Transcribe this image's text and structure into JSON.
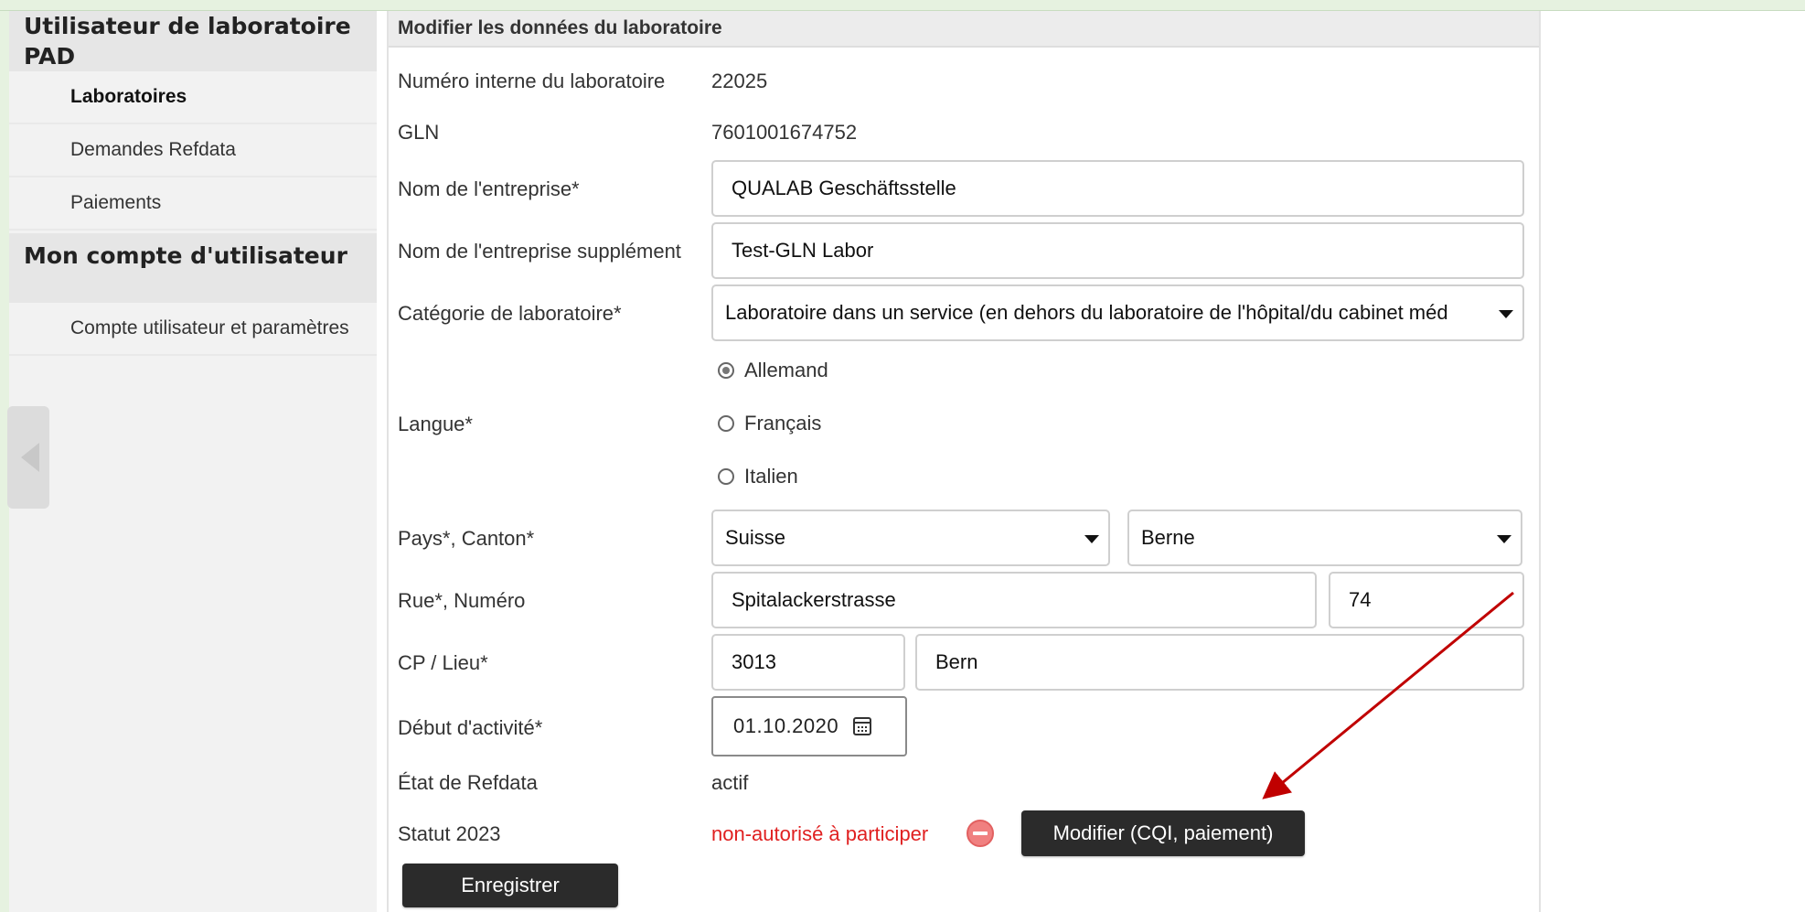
{
  "sidebar": {
    "section1": "Utilisateur de laboratoire PAD",
    "items1": [
      {
        "label": "Laboratoires"
      },
      {
        "label": "Demandes Refdata"
      },
      {
        "label": "Paiements"
      }
    ],
    "section2": "Mon compte d'utilisateur",
    "items2": [
      {
        "label": "Compte utilisateur et paramètres"
      }
    ]
  },
  "panel": {
    "title": "Modifier les données du laboratoire"
  },
  "form": {
    "internal_no_label": "Numéro interne du laboratoire",
    "internal_no": "22025",
    "gln_label": "GLN",
    "gln": "7601001674752",
    "company_label": "Nom de l'entreprise*",
    "company": "QUALAB Geschäftsstelle",
    "company_extra_label": "Nom de l'entreprise supplément",
    "company_extra": "Test-GLN Labor",
    "category_label": "Catégorie de laboratoire*",
    "category": "Laboratoire dans un service (en dehors du laboratoire de l'hôpital/du cabinet méd",
    "language_label": "Langue*",
    "languages": [
      {
        "label": "Allemand",
        "selected": true
      },
      {
        "label": "Français",
        "selected": false
      },
      {
        "label": "Italien",
        "selected": false
      }
    ],
    "country_canton_label": "Pays*, Canton*",
    "country": "Suisse",
    "canton": "Berne",
    "street_label": "Rue*, Numéro",
    "street": "Spitalackerstrasse",
    "number": "74",
    "zip_city_label": "CP / Lieu*",
    "zip": "3013",
    "city": "Bern",
    "start_label": "Début d'activité*",
    "start_date": "01.10.2020",
    "refdata_label": "État de Refdata",
    "refdata_state": "actif",
    "status_label": "Statut 2023",
    "status_value": "non-autorisé à participer",
    "modify_button": "Modifier (CQI, paiement)",
    "save_button": "Enregistrer"
  },
  "colors": {
    "status_red": "#e02020",
    "annotation_arrow": "#c00000",
    "button_bg": "#2b2b2b"
  }
}
